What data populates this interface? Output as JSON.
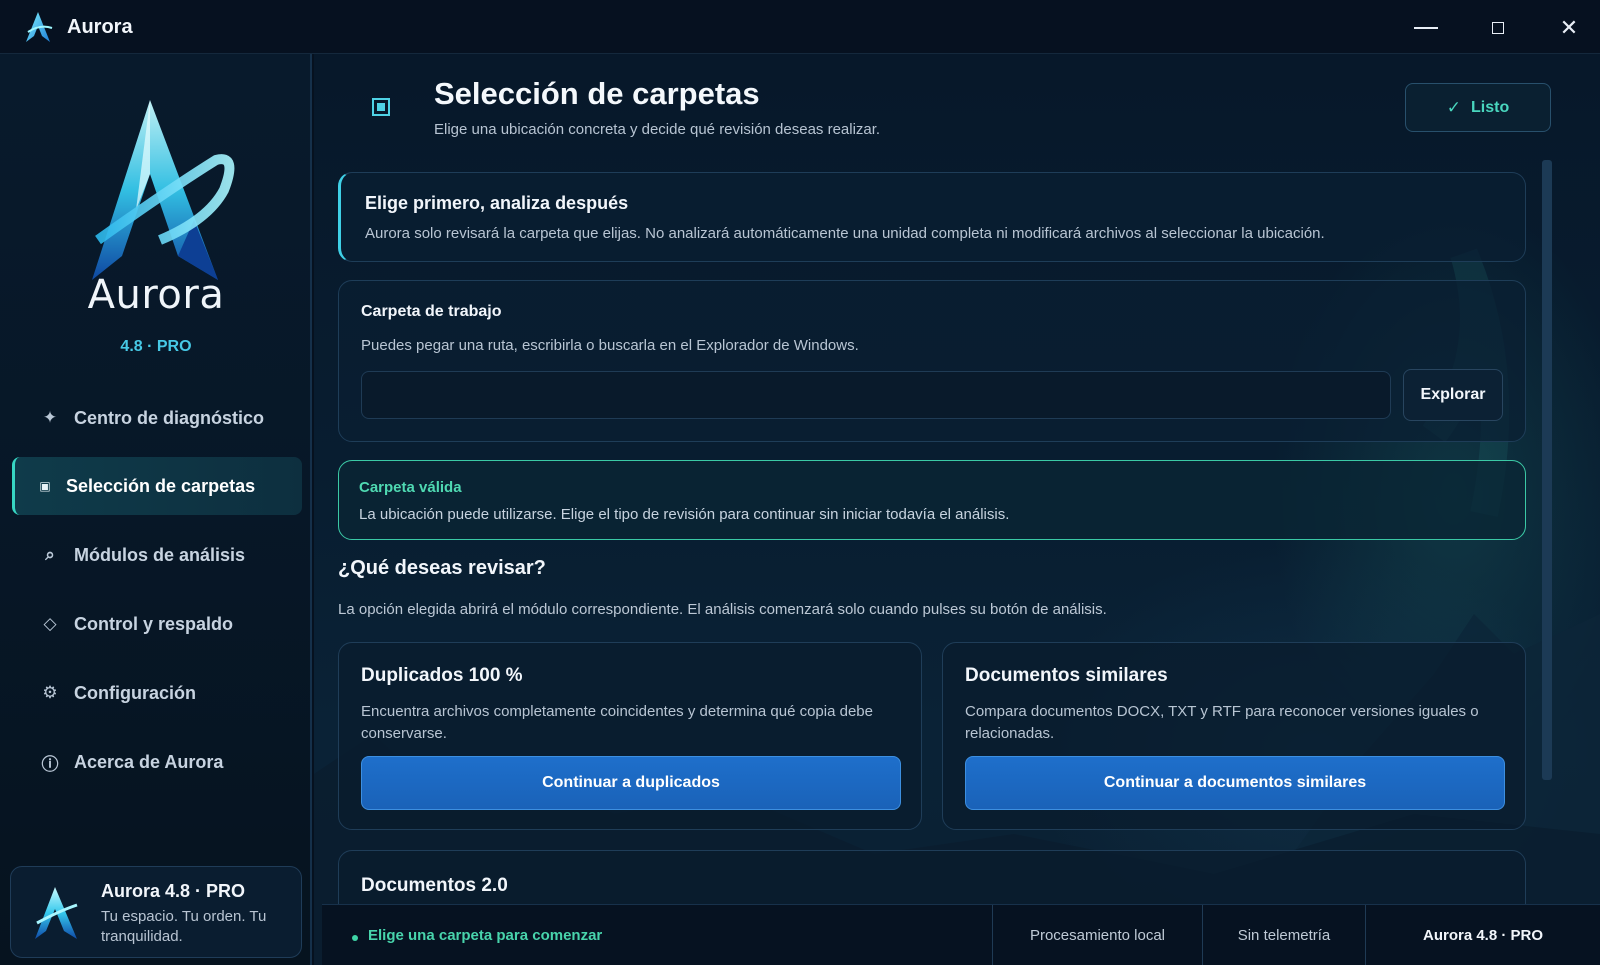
{
  "app": {
    "title": "Aurora"
  },
  "window_controls": {
    "minimize": "—",
    "maximize": "□",
    "close": "✕"
  },
  "sidebar": {
    "brand": "Aurora",
    "version": "4.8 · PRO",
    "items": [
      {
        "label": "Centro de diagnóstico",
        "icon": "sparkle-icon",
        "glyph": "✦"
      },
      {
        "label": "Selección de carpetas",
        "icon": "folder-square-icon",
        "glyph": "▣",
        "active": true
      },
      {
        "label": "Módulos de análisis",
        "icon": "search-icon",
        "glyph": "⌕"
      },
      {
        "label": "Control y respaldo",
        "icon": "diamond-icon",
        "glyph": "◇"
      },
      {
        "label": "Configuración",
        "icon": "gear-icon",
        "glyph": "⚙"
      },
      {
        "label": "Acerca de Aurora",
        "icon": "info-icon",
        "glyph": "ⓘ"
      }
    ],
    "card": {
      "title": "Aurora 4.8 · PRO",
      "subtitle": "Tu espacio. Tu orden. Tu tranquilidad."
    }
  },
  "header": {
    "title": "Selección de carpetas",
    "subtitle": "Elige una ubicación concreta y decide qué revisión deseas realizar.",
    "done_label": "Listo",
    "done_glyph": "✓"
  },
  "info": {
    "title": "Elige primero, analiza después",
    "text": "Aurora solo revisará la carpeta que elijas. No analizará automáticamente una unidad completa ni modificará archivos al seleccionar la ubicación."
  },
  "folder": {
    "label": "Carpeta de trabajo",
    "help": "Puedes pegar una ruta, escribirla o buscarla en el Explorador de Windows.",
    "value": "",
    "placeholder": "",
    "browse_label": "Explorar"
  },
  "validation": {
    "title": "Carpeta válida",
    "text": "La ubicación puede utilizarse. Elige el tipo de revisión para continuar sin iniciar todavía el análisis."
  },
  "review": {
    "question": "¿Qué deseas revisar?",
    "help": "La opción elegida abrirá el módulo correspondiente. El análisis comenzará solo cuando pulses su botón de análisis.",
    "options": [
      {
        "title": "Duplicados 100 %",
        "description": "Encuentra archivos completamente coincidentes y determina qué copia debe conservarse.",
        "button": "Continuar a duplicados"
      },
      {
        "title": "Documentos similares",
        "description": "Compara documentos DOCX, TXT y RTF para reconocer versiones iguales o relacionadas.",
        "button": "Continuar a documentos similares"
      },
      {
        "title": "Documentos 2.0"
      }
    ]
  },
  "status": {
    "message": "Elige una carpeta para comenzar",
    "segments": [
      "Procesamiento local",
      "Sin telemetría",
      "Aurora 4.8 · PRO"
    ]
  },
  "colors": {
    "accent_cyan": "#3fd0e6",
    "accent_green": "#48d4ac",
    "button_blue": "#1e6fcb",
    "background": "#06111f"
  }
}
